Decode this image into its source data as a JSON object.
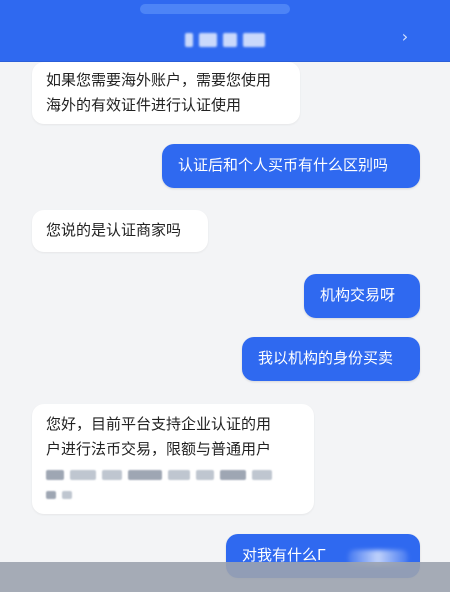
{
  "header": {
    "title_redacted": true,
    "arrow_glyph": "›"
  },
  "messages": [
    {
      "side": "left",
      "lines": [
        "如果您需要海外账户，需要您使用",
        "海外的有效证件进行认证使用"
      ]
    },
    {
      "side": "right",
      "text": "认证后和个人买币有什么区别吗"
    },
    {
      "side": "left",
      "text": "您说的是认证商家吗"
    },
    {
      "side": "right",
      "text": "机构交易呀"
    },
    {
      "side": "right",
      "text": "我以机构的身份买卖"
    },
    {
      "side": "left",
      "lines": [
        "您好，目前平台支持企业认证的用",
        "户进行法币交易，限额与普通用户"
      ],
      "redacted_tail": true
    },
    {
      "side": "right",
      "text": "对我有什么Γ"
    }
  ],
  "colors": {
    "header_blue": "#2f69f0",
    "user_bubble": "#2f69f0",
    "agent_bubble": "#ffffff",
    "background": "#f3f4f6"
  }
}
